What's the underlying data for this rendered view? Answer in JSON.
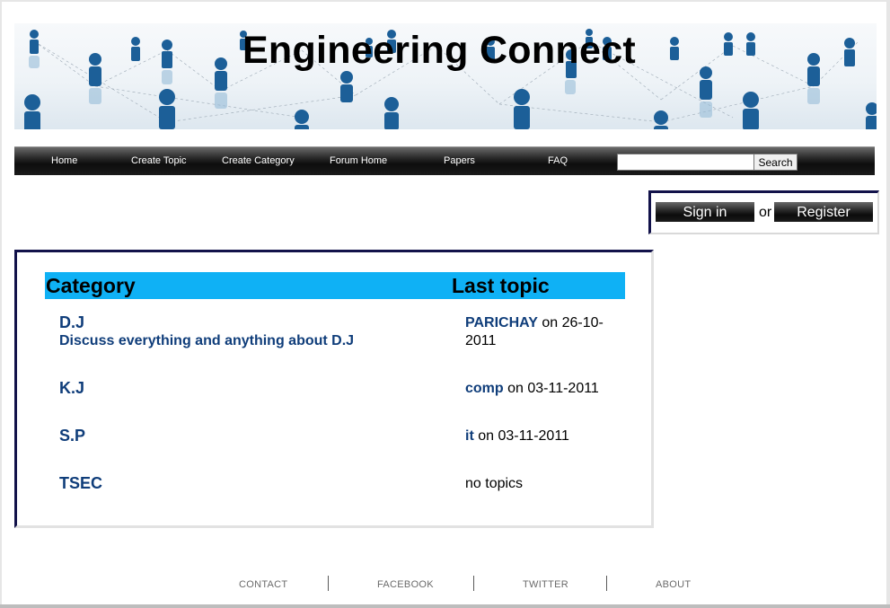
{
  "header": {
    "site_title": "Engineering Connect"
  },
  "nav": {
    "items": [
      "Home",
      "Create Topic",
      "Create Category",
      "Forum Home",
      "Papers",
      "FAQ"
    ],
    "search_value": "",
    "search_button": "Search"
  },
  "auth": {
    "sign_in": "Sign in",
    "or": "or",
    "register": "Register"
  },
  "forum": {
    "col_category": "Category",
    "col_last_topic": "Last topic",
    "rows": [
      {
        "name": "D.J",
        "description": "Discuss everything and anything about D.J",
        "topic": "PARICHAY",
        "date": " on 26-10-2011"
      },
      {
        "name": "K.J",
        "description": "",
        "topic": "comp",
        "date": " on 03-11-2011"
      },
      {
        "name": "S.P",
        "description": "",
        "topic": "it",
        "date": " on 03-11-2011"
      },
      {
        "name": "TSEC",
        "description": "",
        "topic": "",
        "date": "no topics"
      }
    ]
  },
  "footer": {
    "links": [
      "CONTACT",
      "FACEBOOK",
      "TWITTER",
      "ABOUT"
    ]
  },
  "colors": {
    "header_bar": "#0fb1f5",
    "link_blue": "#0f3d7a",
    "box_border": "#12124a"
  }
}
